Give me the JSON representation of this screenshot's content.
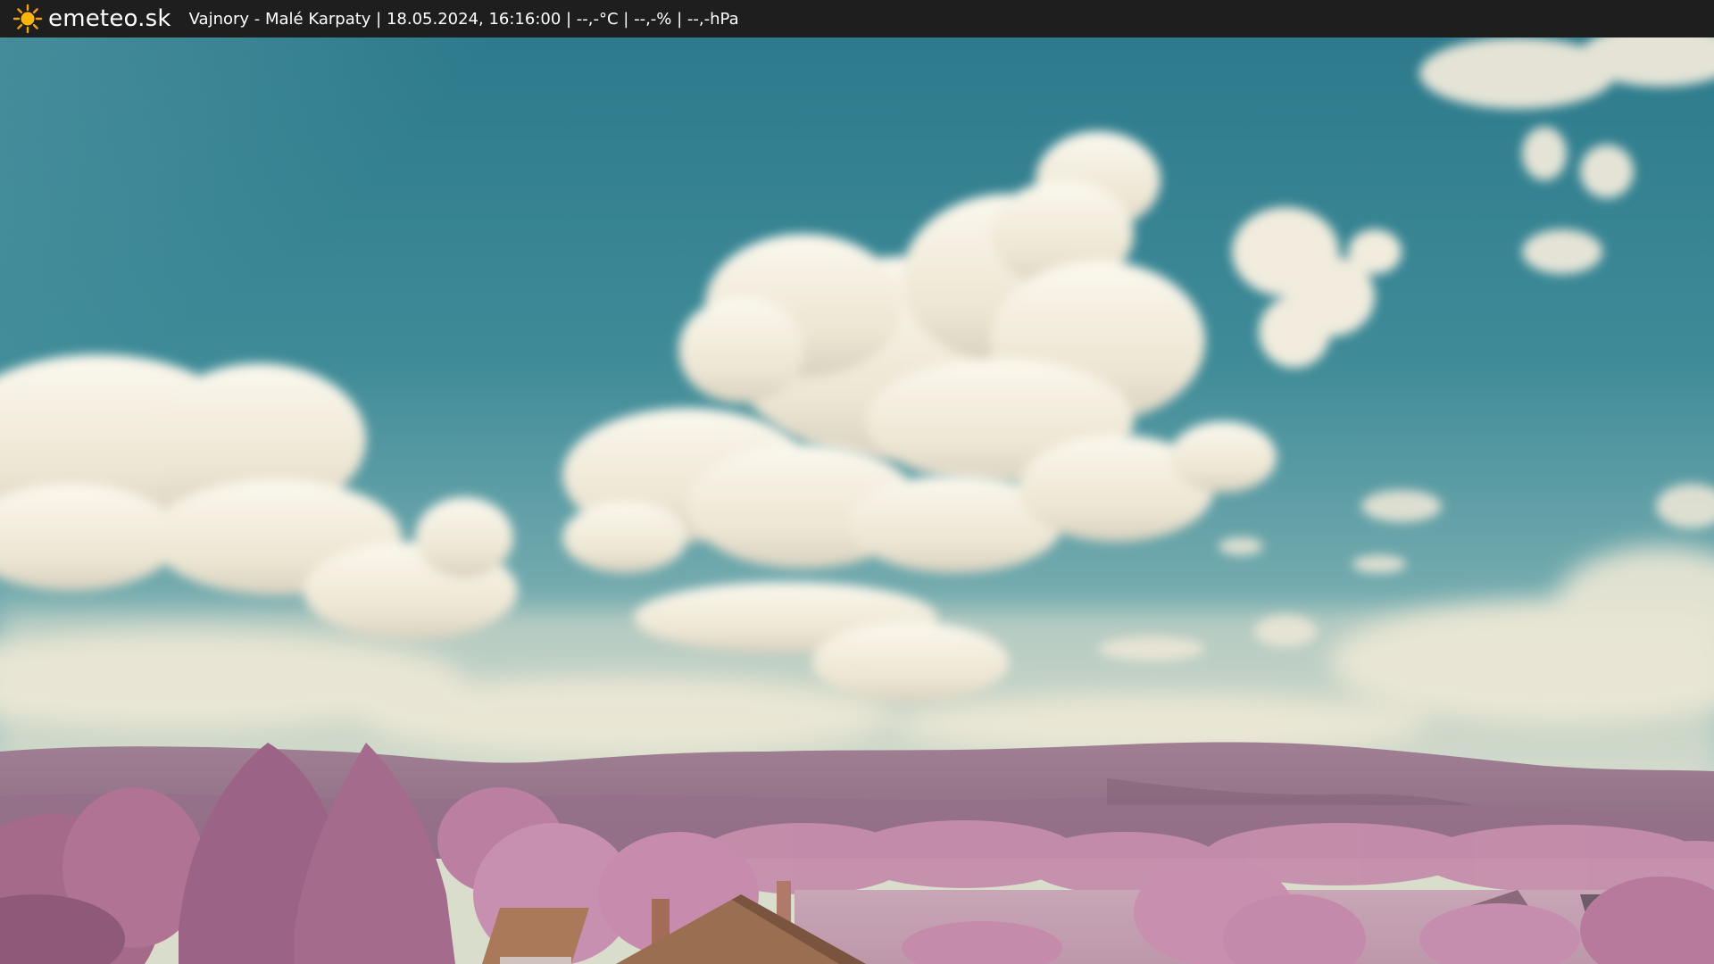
{
  "header": {
    "brand": "emeteo.sk",
    "caption": "Vajnory - Malé Karpaty | 18.05.2024, 16:16:00 | --,-°C | --,-% | --,-hPa",
    "icon": "sun-icon",
    "background": "#1e1e1e",
    "text_color": "#ffffff"
  },
  "scene": {
    "icon": "webcam-image",
    "sky_top": "#2f7e8f",
    "sky_horizon": "#a9c9c2",
    "cloud_color": "#f3efe1",
    "hill_color": "#8f6f86",
    "foliage_color": "#c48bab",
    "roof_color": "#9a6e50"
  }
}
